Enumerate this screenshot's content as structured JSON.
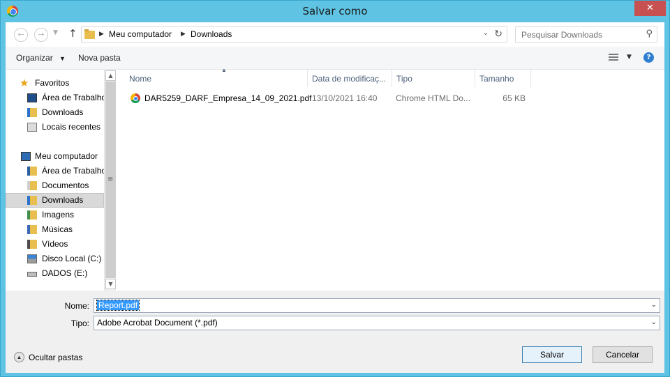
{
  "window": {
    "title": "Salvar como",
    "close_glyph": "✕"
  },
  "address": {
    "crumbs": [
      "Meu computador",
      "Downloads"
    ],
    "search_placeholder": "Pesquisar Downloads"
  },
  "toolbar": {
    "organize": "Organizar",
    "new_folder": "Nova pasta",
    "help": "?"
  },
  "nav_pane": {
    "groups": [
      {
        "label": "Favoritos",
        "items": [
          "Área de Trabalho",
          "Downloads",
          "Locais recentes"
        ]
      },
      {
        "label": "Meu computador",
        "items": [
          "Área de Trabalho",
          "Documentos",
          "Downloads",
          "Imagens",
          "Músicas",
          "Vídeos",
          "Disco Local (C:)",
          "DADOS (E:)"
        ]
      }
    ],
    "selected": "Downloads"
  },
  "columns": [
    "Nome",
    "Data de modificaç...",
    "Tipo",
    "Tamanho"
  ],
  "files": [
    {
      "name": "DAR5259_DARF_Empresa_14_09_2021.pdf",
      "modified": "13/10/2021 16:40",
      "type": "Chrome HTML Do...",
      "size": "65 KB",
      "icon": "chrome-icon"
    }
  ],
  "form": {
    "name_label": "Nome:",
    "name_value": "Report.pdf",
    "type_label": "Tipo:",
    "type_value": "Adobe Acrobat Document (*.pdf)"
  },
  "footer": {
    "hide_folders": "Ocultar pastas",
    "save": "Salvar",
    "cancel": "Cancelar"
  }
}
